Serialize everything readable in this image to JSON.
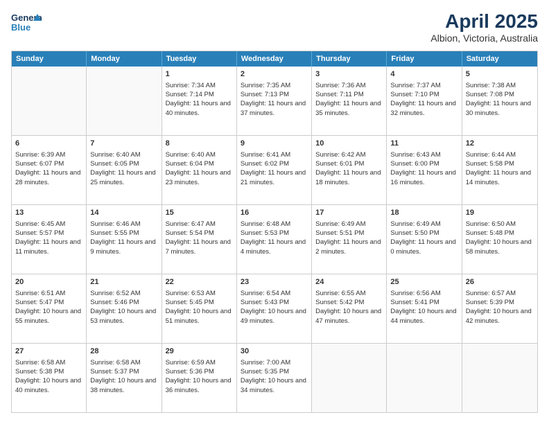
{
  "header": {
    "logo_line1": "General",
    "logo_line2": "Blue",
    "main_title": "April 2025",
    "sub_title": "Albion, Victoria, Australia"
  },
  "calendar": {
    "days_of_week": [
      "Sunday",
      "Monday",
      "Tuesday",
      "Wednesday",
      "Thursday",
      "Friday",
      "Saturday"
    ],
    "weeks": [
      [
        {
          "day": "",
          "empty": true
        },
        {
          "day": "",
          "empty": true
        },
        {
          "day": "1",
          "text": "Sunrise: 7:34 AM\nSunset: 7:14 PM\nDaylight: 11 hours and 40 minutes."
        },
        {
          "day": "2",
          "text": "Sunrise: 7:35 AM\nSunset: 7:13 PM\nDaylight: 11 hours and 37 minutes."
        },
        {
          "day": "3",
          "text": "Sunrise: 7:36 AM\nSunset: 7:11 PM\nDaylight: 11 hours and 35 minutes."
        },
        {
          "day": "4",
          "text": "Sunrise: 7:37 AM\nSunset: 7:10 PM\nDaylight: 11 hours and 32 minutes."
        },
        {
          "day": "5",
          "text": "Sunrise: 7:38 AM\nSunset: 7:08 PM\nDaylight: 11 hours and 30 minutes."
        }
      ],
      [
        {
          "day": "6",
          "text": "Sunrise: 6:39 AM\nSunset: 6:07 PM\nDaylight: 11 hours and 28 minutes."
        },
        {
          "day": "7",
          "text": "Sunrise: 6:40 AM\nSunset: 6:05 PM\nDaylight: 11 hours and 25 minutes."
        },
        {
          "day": "8",
          "text": "Sunrise: 6:40 AM\nSunset: 6:04 PM\nDaylight: 11 hours and 23 minutes."
        },
        {
          "day": "9",
          "text": "Sunrise: 6:41 AM\nSunset: 6:02 PM\nDaylight: 11 hours and 21 minutes."
        },
        {
          "day": "10",
          "text": "Sunrise: 6:42 AM\nSunset: 6:01 PM\nDaylight: 11 hours and 18 minutes."
        },
        {
          "day": "11",
          "text": "Sunrise: 6:43 AM\nSunset: 6:00 PM\nDaylight: 11 hours and 16 minutes."
        },
        {
          "day": "12",
          "text": "Sunrise: 6:44 AM\nSunset: 5:58 PM\nDaylight: 11 hours and 14 minutes."
        }
      ],
      [
        {
          "day": "13",
          "text": "Sunrise: 6:45 AM\nSunset: 5:57 PM\nDaylight: 11 hours and 11 minutes."
        },
        {
          "day": "14",
          "text": "Sunrise: 6:46 AM\nSunset: 5:55 PM\nDaylight: 11 hours and 9 minutes."
        },
        {
          "day": "15",
          "text": "Sunrise: 6:47 AM\nSunset: 5:54 PM\nDaylight: 11 hours and 7 minutes."
        },
        {
          "day": "16",
          "text": "Sunrise: 6:48 AM\nSunset: 5:53 PM\nDaylight: 11 hours and 4 minutes."
        },
        {
          "day": "17",
          "text": "Sunrise: 6:49 AM\nSunset: 5:51 PM\nDaylight: 11 hours and 2 minutes."
        },
        {
          "day": "18",
          "text": "Sunrise: 6:49 AM\nSunset: 5:50 PM\nDaylight: 11 hours and 0 minutes."
        },
        {
          "day": "19",
          "text": "Sunrise: 6:50 AM\nSunset: 5:48 PM\nDaylight: 10 hours and 58 minutes."
        }
      ],
      [
        {
          "day": "20",
          "text": "Sunrise: 6:51 AM\nSunset: 5:47 PM\nDaylight: 10 hours and 55 minutes."
        },
        {
          "day": "21",
          "text": "Sunrise: 6:52 AM\nSunset: 5:46 PM\nDaylight: 10 hours and 53 minutes."
        },
        {
          "day": "22",
          "text": "Sunrise: 6:53 AM\nSunset: 5:45 PM\nDaylight: 10 hours and 51 minutes."
        },
        {
          "day": "23",
          "text": "Sunrise: 6:54 AM\nSunset: 5:43 PM\nDaylight: 10 hours and 49 minutes."
        },
        {
          "day": "24",
          "text": "Sunrise: 6:55 AM\nSunset: 5:42 PM\nDaylight: 10 hours and 47 minutes."
        },
        {
          "day": "25",
          "text": "Sunrise: 6:56 AM\nSunset: 5:41 PM\nDaylight: 10 hours and 44 minutes."
        },
        {
          "day": "26",
          "text": "Sunrise: 6:57 AM\nSunset: 5:39 PM\nDaylight: 10 hours and 42 minutes."
        }
      ],
      [
        {
          "day": "27",
          "text": "Sunrise: 6:58 AM\nSunset: 5:38 PM\nDaylight: 10 hours and 40 minutes."
        },
        {
          "day": "28",
          "text": "Sunrise: 6:58 AM\nSunset: 5:37 PM\nDaylight: 10 hours and 38 minutes."
        },
        {
          "day": "29",
          "text": "Sunrise: 6:59 AM\nSunset: 5:36 PM\nDaylight: 10 hours and 36 minutes."
        },
        {
          "day": "30",
          "text": "Sunrise: 7:00 AM\nSunset: 5:35 PM\nDaylight: 10 hours and 34 minutes."
        },
        {
          "day": "",
          "empty": true
        },
        {
          "day": "",
          "empty": true
        },
        {
          "day": "",
          "empty": true
        }
      ]
    ]
  }
}
